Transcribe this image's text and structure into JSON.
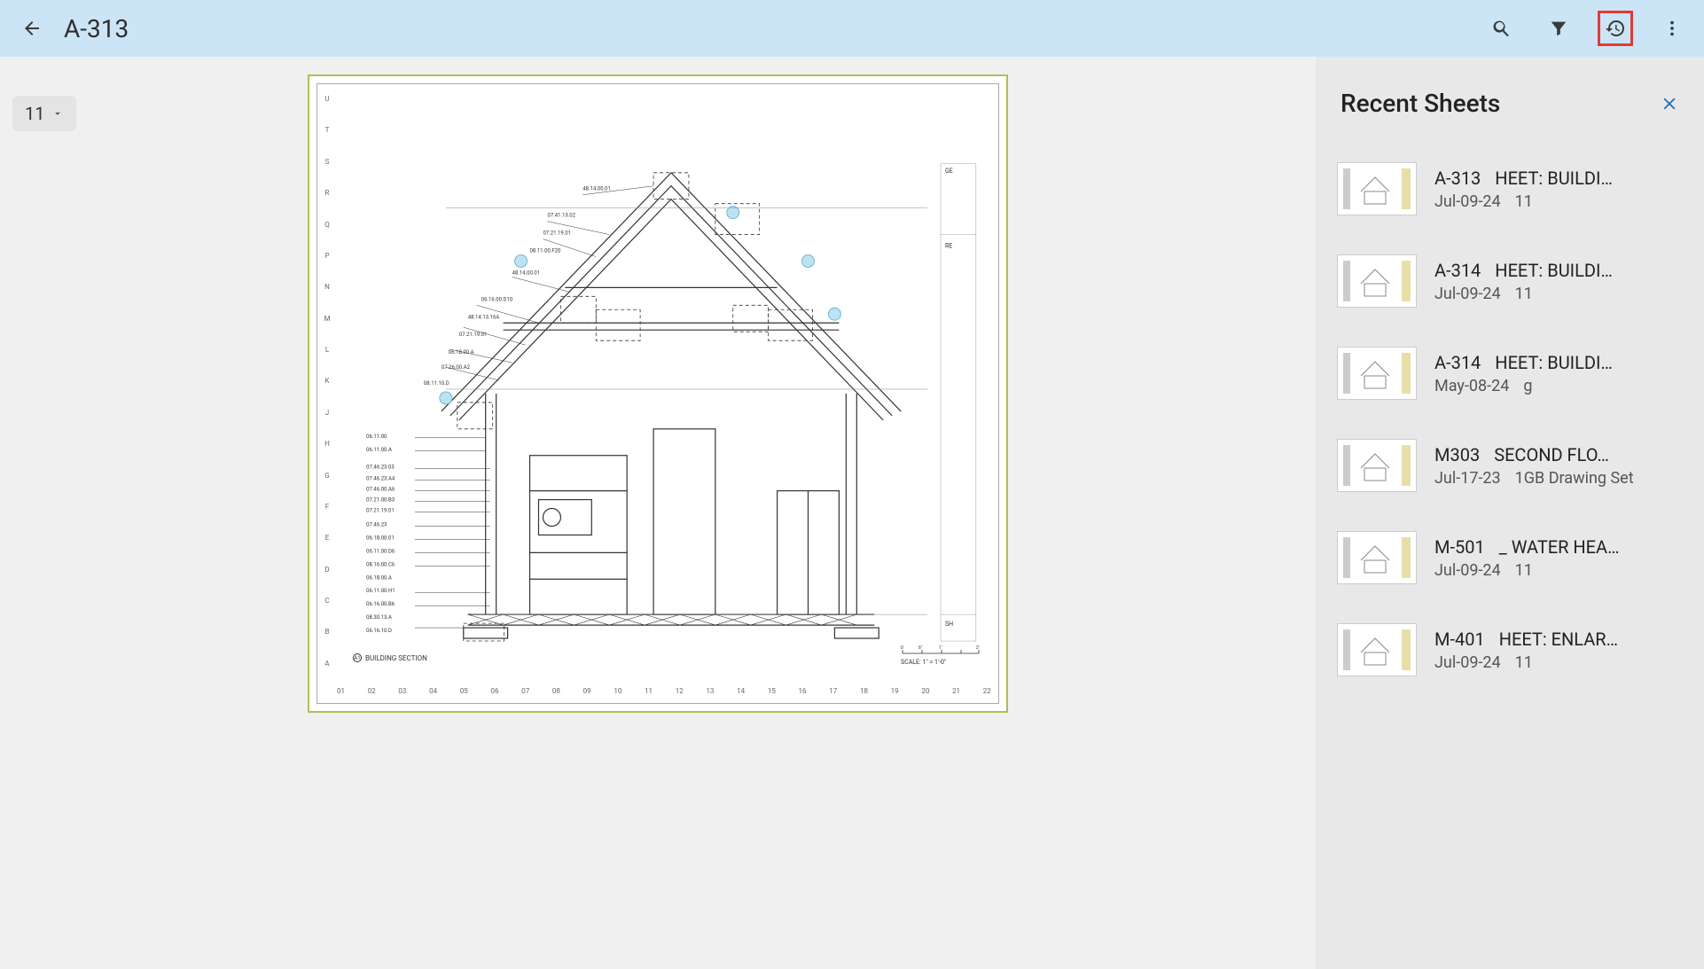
{
  "header": {
    "title": "A-313"
  },
  "version": {
    "current": "11"
  },
  "drawing": {
    "row_labels": [
      "U",
      "T",
      "S",
      "R",
      "Q",
      "P",
      "N",
      "M",
      "L",
      "K",
      "J",
      "H",
      "G",
      "F",
      "E",
      "D",
      "C",
      "B",
      "A"
    ],
    "col_labels": [
      "01",
      "02",
      "03",
      "04",
      "05",
      "06",
      "07",
      "08",
      "09",
      "10",
      "11",
      "12",
      "13",
      "14",
      "15",
      "16",
      "17",
      "18",
      "19",
      "20",
      "21",
      "22"
    ],
    "section_tag": "A1",
    "section_title": "BUILDING SECTION",
    "scale_note": "SCALE: 1\" = 1'-0\"",
    "keynotes": [
      "48.14.00.01",
      "07.41.13.02",
      "07.21.19.01",
      "08.11.00.F20",
      "48.14.00.01",
      "06.16.00.D10",
      "48.14.13.16A",
      "07.21.19.01",
      "06.18.00.A",
      "07.26.00.A2",
      "08.11.10.D",
      "06.11.00",
      "06.11.00.A",
      "07.46.23.03",
      "07.46.23.A4",
      "07.46.00.A6",
      "07.21.00.B3",
      "07.21.19.01",
      "07.46.23",
      "06.18.00.01",
      "06.11.00.D6",
      "08.16.00.C6",
      "06.18.00.A",
      "06.11.00.H1",
      "06.16.00.B6",
      "08.30.13.A",
      "06.16.10.D"
    ],
    "right_tags": [
      "GE",
      "RE",
      "SH"
    ]
  },
  "recent": {
    "title": "Recent Sheets",
    "items": [
      {
        "code": "A-313",
        "name": "HEET: BUILDI…",
        "date": "Jul-09-24",
        "ver": "11"
      },
      {
        "code": "A-314",
        "name": "HEET: BUILDI…",
        "date": "Jul-09-24",
        "ver": "11"
      },
      {
        "code": "A-314",
        "name": "HEET: BUILDI…",
        "date": "May-08-24",
        "ver": "g"
      },
      {
        "code": "M303",
        "name": "SECOND FLO…",
        "date": "Jul-17-23",
        "ver": "1GB Drawing Set"
      },
      {
        "code": "M-501",
        "name": "_ WATER HEA…",
        "date": "Jul-09-24",
        "ver": "11"
      },
      {
        "code": "M-401",
        "name": "HEET: ENLAR…",
        "date": "Jul-09-24",
        "ver": "11"
      }
    ]
  }
}
